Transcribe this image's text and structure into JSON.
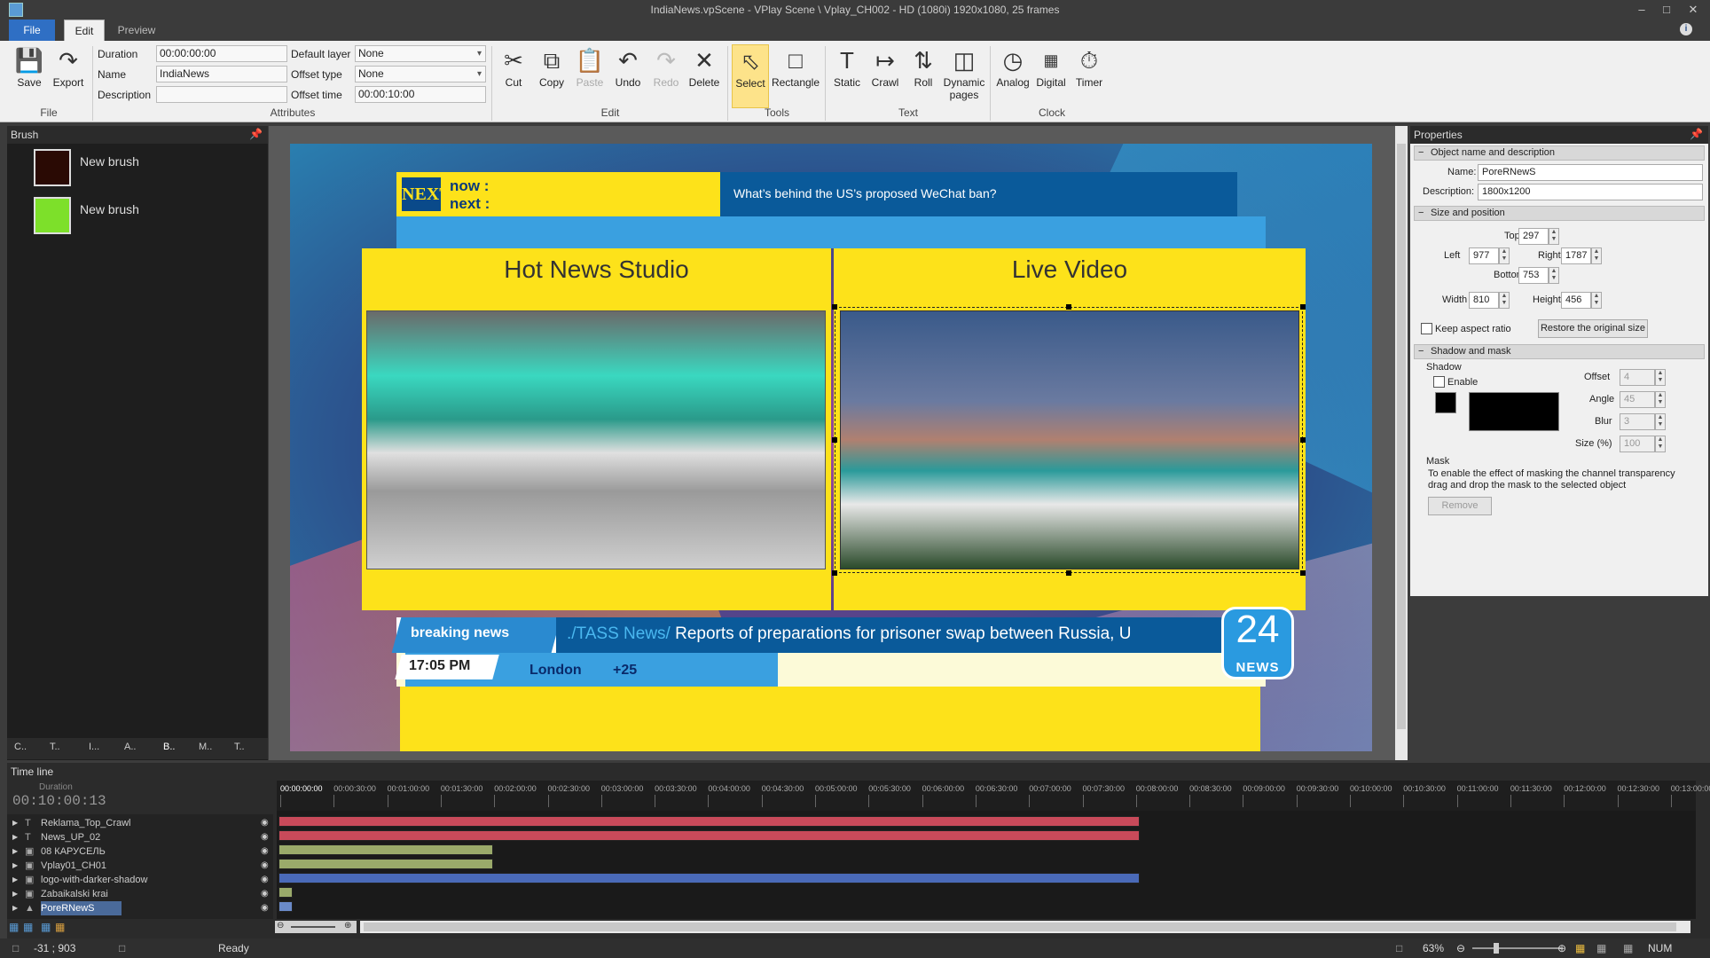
{
  "window": {
    "title": "IndiaNews.vpScene - VPlay Scene \\ Vplay_CH002 - HD (1080i) 1920x1080, 25 frames"
  },
  "tabs": {
    "file": "File",
    "edit": "Edit",
    "preview": "Preview"
  },
  "ribbon": {
    "file": {
      "save": "Save",
      "export": "Export",
      "group": "File"
    },
    "attributes": {
      "duration_label": "Duration",
      "duration_value": "00:00:00:00",
      "name_label": "Name",
      "name_value": "IndiaNews",
      "description_label": "Description",
      "description_value": "",
      "default_layer_label": "Default layer",
      "default_layer_value": "None",
      "offset_type_label": "Offset type",
      "offset_type_value": "None",
      "offset_time_label": "Offset time",
      "offset_time_value": "00:00:10:00",
      "group": "Attributes"
    },
    "edit": {
      "cut": "Cut",
      "copy": "Copy",
      "paste": "Paste",
      "undo": "Undo",
      "redo": "Redo",
      "delete": "Delete",
      "group": "Edit"
    },
    "tools": {
      "select": "Select",
      "rectangle": "Rectangle",
      "group": "Tools"
    },
    "text": {
      "static": "Static",
      "crawl": "Crawl",
      "roll": "Roll",
      "dynamic": "Dynamic",
      "dynamic2": "pages",
      "group": "Text"
    },
    "clock": {
      "analog": "Analog",
      "digital": "Digital",
      "timer": "Timer",
      "group": "Clock"
    }
  },
  "brush_panel": {
    "title": "Brush",
    "items": [
      {
        "label": "New brush",
        "color": "#2a0a04"
      },
      {
        "label": "New brush",
        "color": "#7de02a"
      }
    ],
    "bottom_tabs": [
      "C..",
      "T..",
      "I...",
      "A..",
      "B..",
      "M..",
      "T.."
    ]
  },
  "scene": {
    "next_logo": "NEXT",
    "now_label": "now :",
    "next_label": "next :",
    "headline": "What’s behind the US’s proposed WeChat ban?",
    "left_panel_title": "Hot News Studio",
    "right_panel_title": "Live Video",
    "breaking_label": "breaking news",
    "ticker_source": "./TASS News/",
    "ticker_text": " Reports of preparations for prisoner swap between Russia, U",
    "time": "17:05 PM",
    "city": "London",
    "temperature": "+25",
    "channel_number": "24",
    "channel_label": "NEWS"
  },
  "properties": {
    "title": "Properties",
    "section_name": "Object name and description",
    "name_label": "Name:",
    "name_value": "PoreRNewS",
    "description_label": "Description:",
    "description_value": "1800x1200",
    "section_size": "Size and position",
    "top_label": "Top",
    "top_value": "297",
    "left_label": "Left",
    "left_value": "977",
    "right_label": "Right",
    "right_value": "1787",
    "bottom_label": "Bottom",
    "bottom_value": "753",
    "width_label": "Width",
    "width_value": "810",
    "height_label": "Height",
    "height_value": "456",
    "keep_aspect": "Keep aspect ratio",
    "restore": "Restore the original size",
    "section_shadow": "Shadow and mask",
    "shadow_label": "Shadow",
    "enable": "Enable",
    "offset_label": "Offset",
    "offset_value": "4",
    "angle_label": "Angle",
    "angle_value": "45",
    "blur_label": "Blur",
    "blur_value": "3",
    "size_label": "Size (%)",
    "size_value": "100",
    "mask_label": "Mask",
    "mask_help": "To enable the effect of masking the channel transparency drag and drop the mask to the selected object",
    "remove": "Remove"
  },
  "timeline": {
    "title": "Time line",
    "duration_label": "Duration",
    "duration_value": "00:10:00:13",
    "ticks": [
      "00:00:00:00",
      "00:00:30:00",
      "00:01:00:00",
      "00:01:30:00",
      "00:02:00:00",
      "00:02:30:00",
      "00:03:00:00",
      "00:03:30:00",
      "00:04:00:00",
      "00:04:30:00",
      "00:05:00:00",
      "00:05:30:00",
      "00:06:00:00",
      "00:06:30:00",
      "00:07:00:00",
      "00:07:30:00",
      "00:08:00:00",
      "00:08:30:00",
      "00:09:00:00",
      "00:09:30:00",
      "00:10:00:00",
      "00:10:30:00",
      "00:11:00:00",
      "00:11:30:00",
      "00:12:00:00",
      "00:12:30:00",
      "00:13:00:00"
    ],
    "tracks": [
      {
        "name": "Reklama_Top_Crawl",
        "icon": "T",
        "bar_end": 0.61,
        "color": "#c84a5a"
      },
      {
        "name": "News_UP_02",
        "icon": "T",
        "bar_end": 0.61,
        "color": "#c84a5a"
      },
      {
        "name": "08 КАРУСЕЛЬ",
        "icon": "A",
        "bar_end": 0.152,
        "color": "#9aaa6a"
      },
      {
        "name": "Vplay01_CH01",
        "icon": "A",
        "bar_end": 0.152,
        "color": "#9aaa6a"
      },
      {
        "name": "logo-with-darker-shadow",
        "icon": "A",
        "bar_end": 0.61,
        "color": "#4a6ab8"
      },
      {
        "name": "Zabaikalski krai",
        "icon": "A",
        "bar_end": 0.01,
        "color": "#9aaa6a"
      },
      {
        "name": "PoreRNewS",
        "icon": "A",
        "bar_end": 0.01,
        "color": "#6a8ac8"
      }
    ]
  },
  "status": {
    "coords": "-31 ; 903",
    "state": "Ready",
    "zoom": "63%",
    "num": "NUM"
  }
}
